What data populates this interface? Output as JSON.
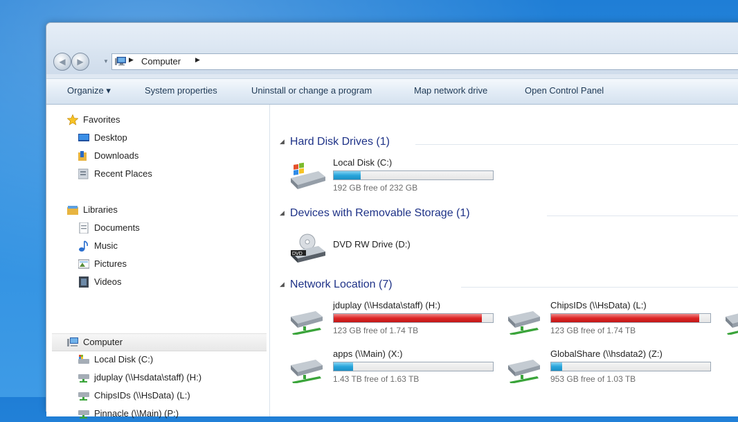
{
  "address": {
    "location": "Computer"
  },
  "toolbar": {
    "organize": "Organize ▾",
    "system_properties": "System properties",
    "uninstall": "Uninstall or change a program",
    "map_network_drive": "Map network drive",
    "open_control_panel": "Open Control Panel"
  },
  "navpane": {
    "favorites": {
      "label": "Favorites",
      "items": [
        {
          "label": "Desktop",
          "icon": "desktop-icon"
        },
        {
          "label": "Downloads",
          "icon": "downloads-folder-icon"
        },
        {
          "label": "Recent Places",
          "icon": "recent-places-icon"
        }
      ]
    },
    "libraries": {
      "label": "Libraries",
      "items": [
        {
          "label": "Documents",
          "icon": "documents-icon"
        },
        {
          "label": "Music",
          "icon": "music-icon"
        },
        {
          "label": "Pictures",
          "icon": "pictures-icon"
        },
        {
          "label": "Videos",
          "icon": "videos-icon"
        }
      ]
    },
    "computer": {
      "label": "Computer",
      "items": [
        {
          "label": "Local Disk (C:)",
          "icon": "local-disk-icon"
        },
        {
          "label": "jduplay (\\\\Hsdata\\staff) (H:)",
          "icon": "network-drive-icon"
        },
        {
          "label": "ChipsIDs (\\\\HsData) (L:)",
          "icon": "network-drive-icon"
        },
        {
          "label": "Pinnacle (\\\\Main) (P:)",
          "icon": "network-drive-icon"
        }
      ]
    }
  },
  "groups": {
    "hard_disk": {
      "title": "Hard Disk Drives (1)",
      "drives": [
        {
          "name": "Local Disk (C:)",
          "free": "192 GB free of 232 GB",
          "used_fraction": 0.17,
          "bar_color": "#29a6dc"
        }
      ]
    },
    "removable": {
      "title": "Devices with Removable Storage (1)",
      "drives": [
        {
          "name": "DVD RW Drive (D:)"
        }
      ]
    },
    "network": {
      "title": "Network Location (7)",
      "drives": [
        {
          "name": "jduplay (\\\\Hsdata\\staff) (H:)",
          "free": "123 GB free of 1.74 TB",
          "used_fraction": 0.93,
          "bar_color": "#dd2626"
        },
        {
          "name": "ChipsIDs (\\\\HsData) (L:)",
          "free": "123 GB free of 1.74 TB",
          "used_fraction": 0.93,
          "bar_color": "#dd2626"
        },
        {
          "name": "apps (\\\\Main) (X:)",
          "free": "1.43 TB free of 1.63 TB",
          "used_fraction": 0.12,
          "bar_color": "#29a6dc"
        },
        {
          "name": "GlobalShare (\\\\hsdata2) (Z:)",
          "free": "953 GB free of 1.03 TB",
          "used_fraction": 0.07,
          "bar_color": "#29a6dc"
        }
      ]
    }
  }
}
